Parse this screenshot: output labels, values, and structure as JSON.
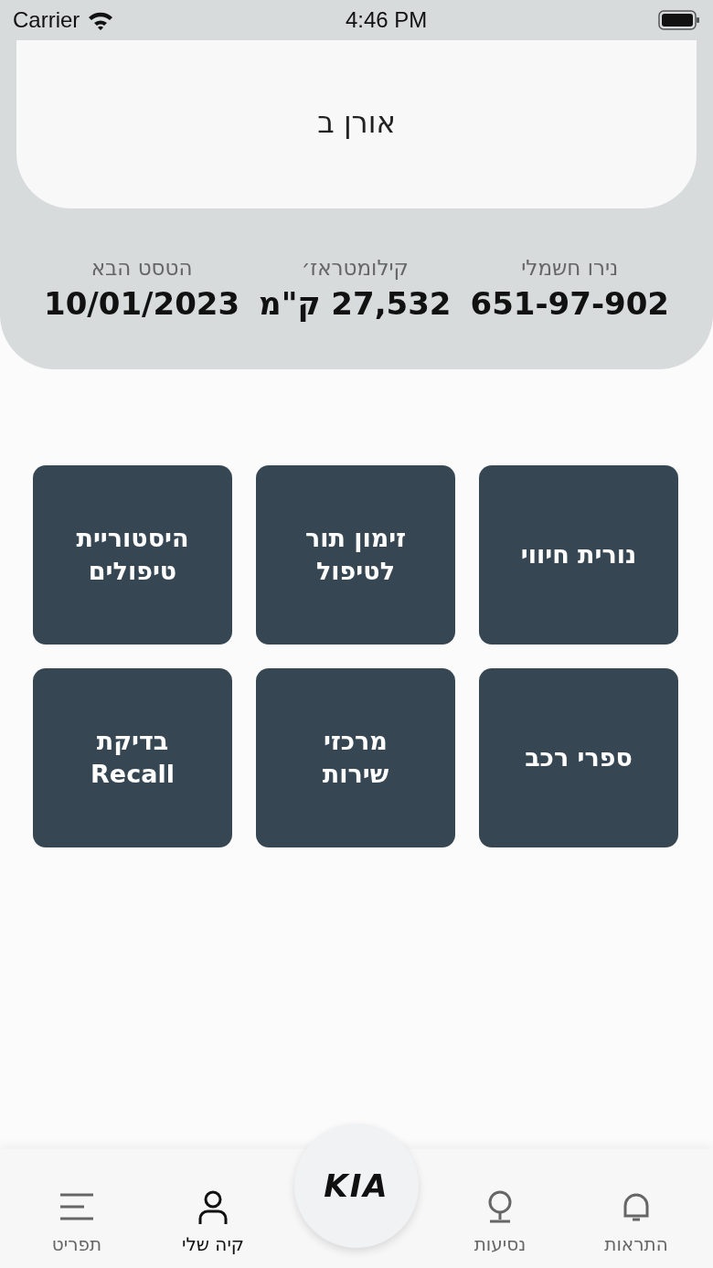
{
  "status_bar": {
    "carrier": "Carrier",
    "time": "4:46 PM"
  },
  "owner": {
    "name": "אורן ב"
  },
  "stats": [
    {
      "label": "נירו חשמלי",
      "value": "651-97-902"
    },
    {
      "label": "קילומטראז׳",
      "value": "27,532 ק\"מ"
    },
    {
      "label": "הטסט הבא",
      "value": "10/01/2023"
    }
  ],
  "tiles": [
    {
      "label": "נורית חיווי"
    },
    {
      "label": "זימון תור לטיפול"
    },
    {
      "label": "היסטוריית טיפולים"
    },
    {
      "label": "ספרי רכב"
    },
    {
      "label": "מרכזי שירות"
    },
    {
      "label": "בדיקת Recall"
    }
  ],
  "tab_bar": {
    "logo": "KIA",
    "items": [
      {
        "kind": "tab",
        "label": "התראות",
        "selected": false
      },
      {
        "kind": "tab",
        "label": "נסיעות",
        "selected": false
      },
      {
        "kind": "logo"
      },
      {
        "kind": "tab",
        "label": "קיה שלי",
        "selected": true
      },
      {
        "kind": "tab",
        "label": "תפריט",
        "selected": false
      }
    ]
  }
}
